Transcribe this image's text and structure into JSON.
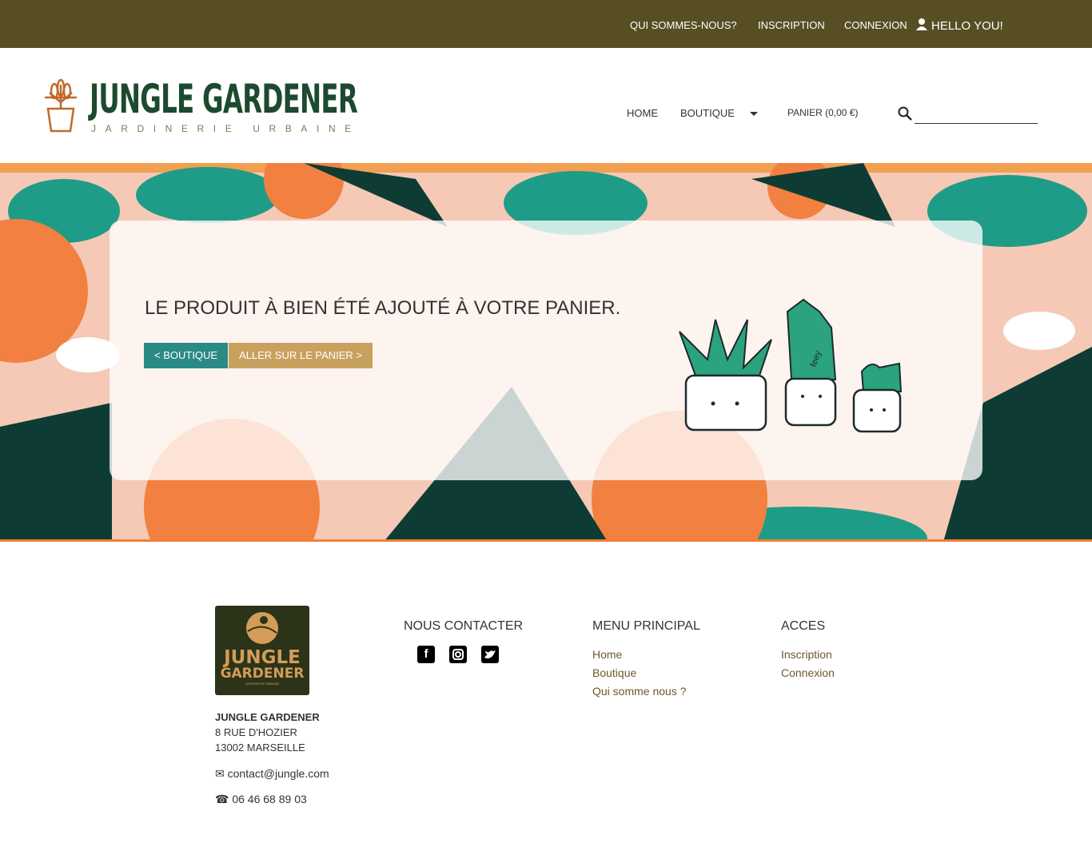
{
  "topbar": {
    "about": "QUI SOMMES-NOUS?",
    "register": "INSCRIPTION",
    "login": "CONNEXION",
    "greeting": "HELLO YOU!"
  },
  "logo": {
    "title": "JUNGLE GARDENER",
    "subtitle": "JARDINERIE URBAINE"
  },
  "nav": {
    "home": "HOME",
    "shop": "BOUTIQUE",
    "cart": "PANIER (0,00 €)",
    "search_value": ""
  },
  "banner": {
    "message": "LE PRODUIT À BIEN ÉTÉ AJOUTÉ À VOTRE PANIER.",
    "back_button": "< BOUTIQUE",
    "cart_button": "ALLER SUR LE PANIER >",
    "plant_tag": "feey"
  },
  "footer": {
    "logo_title_1": "JUNGLE",
    "logo_title_2": "GARDENER",
    "logo_sub": "JARDINERIE URBAINE",
    "company": "JUNGLE GARDENER",
    "address1": "8 RUE D'HOZIER",
    "address2": "13002 MARSEILLE",
    "email": "contact@jungle.com",
    "phone": "06 46 68 89 03",
    "contact_heading": "NOUS CONTACTER",
    "menu_heading": "MENU PRINCIPAL",
    "menu": [
      "Home",
      "Boutique",
      "Qui somme nous ?"
    ],
    "access_heading": "ACCES",
    "access": [
      "Inscription",
      "Connexion"
    ]
  },
  "colors": {
    "topbar": "#584e23",
    "teal_button": "#2b8a86",
    "tan_button": "#c9a15e",
    "logo_green": "#1c4a2f",
    "orange": "#f08038"
  }
}
